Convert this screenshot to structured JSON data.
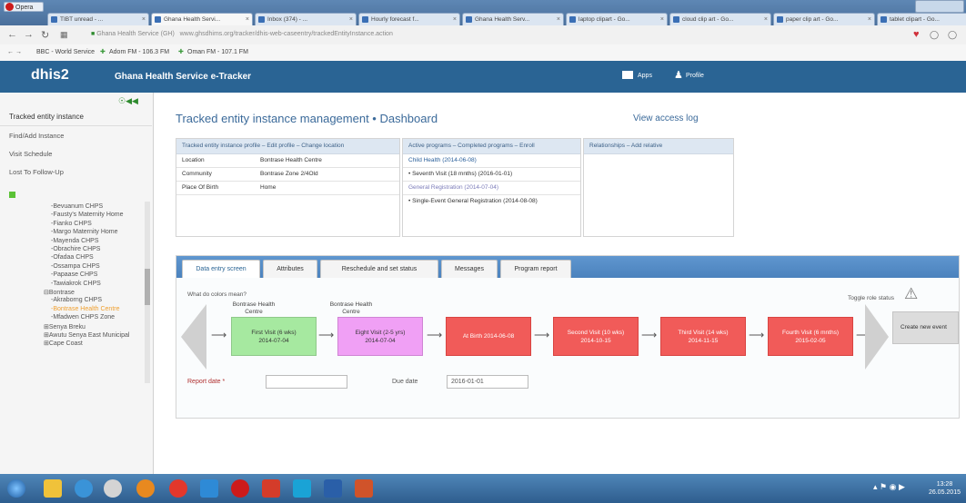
{
  "browser": {
    "app_name": "Opera",
    "tabs": [
      "TIBT unread - ...",
      "Ghana Health Servi...",
      "Inbox (374) - ...",
      "Hourly forecast f...",
      "Ghana Health Serv...",
      "laptop clipart - Go...",
      "cloud clip art - Go...",
      "paper clip art - Go...",
      "tablet clipart - Go..."
    ],
    "active_tab": 1,
    "url_domain": "Ghana Health Service (GH)",
    "url": "www.ghsdhims.org/tracker/dhis-web-caseentry/trackedEntityInstance.action",
    "bookmarks": [
      "BBC - World Service",
      "Adom FM - 106.3 FM",
      "Oman FM - 107.1 FM"
    ]
  },
  "header": {
    "logo": "dhis2",
    "title": "Ghana Health Service e-Tracker",
    "apps_label": "Apps",
    "profile_label": "Profile"
  },
  "sidebar": {
    "heading": "Tracked entity instance",
    "links": [
      "Find/Add Instance",
      "Visit Schedule",
      "Lost To Follow-Up"
    ],
    "tree": [
      "-Bevuanum CHPS",
      "-Fausty's Maternity Home",
      "-Fianko CHPS",
      "-Margo Maternity Home",
      "-Mayenda CHPS",
      "-Obrachire CHPS",
      "-Ofadaa CHPS",
      "-Ossampa CHPS",
      "-Papaase CHPS",
      "-Tawiakrok CHPS",
      "⊟Bontrase",
      "-Akraborng CHPS",
      "-Bontrase Health Centre",
      "-Mfadwen CHPS Zone",
      "⊞Senya Breku",
      "⊞Awutu Senya East Municipal",
      "⊞Cape Coast"
    ],
    "selected_tree_index": 12
  },
  "main": {
    "title": "Tracked entity instance management • Dashboard",
    "access_log": "View access log",
    "profile_panel": {
      "header": "Tracked entity instance profile – Edit profile – Change location",
      "rows": [
        {
          "label": "Location",
          "value": "Bontrase Health Centre"
        },
        {
          "label": "Community",
          "value": "Bontrase Zone 2/4Old"
        },
        {
          "label": "Place Of Birth",
          "value": "Home"
        }
      ]
    },
    "programs_panel": {
      "header": "Active programs – Completed programs – Enroll",
      "items": [
        "Child Health (2014-06-08)",
        "• Seventh Visit (18 mnths) (2016-01-01)",
        "General Registration (2014-07-04)",
        "• Single-Event General Registration (2014-08-08)"
      ]
    },
    "relationships_panel": {
      "header": "Relationships – Add relative"
    },
    "data_tabs": [
      "Data entry screen",
      "Attributes",
      "Reschedule and set status",
      "Messages",
      "Program report"
    ],
    "active_data_tab": 0,
    "colors_question": "What do colors mean?",
    "toggle_label": "Toggle role status",
    "create_event": "Create new event",
    "org_units": [
      "Bontrase Health Centre",
      "Bontrase Health Centre"
    ],
    "stages": [
      {
        "label": "First Visit (6 wks)\n2014-07-04",
        "color": "green"
      },
      {
        "label": "Eight Visit (2-5 yrs)\n2014-07-04",
        "color": "pink"
      },
      {
        "label": "At Birth  2014-06-08",
        "color": "red"
      },
      {
        "label": "Second Visit (10 wks)\n2014-10-15",
        "color": "red"
      },
      {
        "label": "Third Visit (14 wks)\n2014-11-15",
        "color": "red"
      },
      {
        "label": "Fourth Visit (6 mnths)\n2015-02-05",
        "color": "red"
      }
    ],
    "report_date_label": "Report date *",
    "report_date_value": "",
    "due_date_label": "Due date",
    "due_date_value": "2016-01-01"
  },
  "taskbar": {
    "time": "13:28",
    "date": "26.05.2015"
  },
  "colors": {
    "header": "#2a6494",
    "stage_green": "#a6e9a0",
    "stage_pink": "#f0a0f5",
    "stage_red": "#f15b59"
  }
}
